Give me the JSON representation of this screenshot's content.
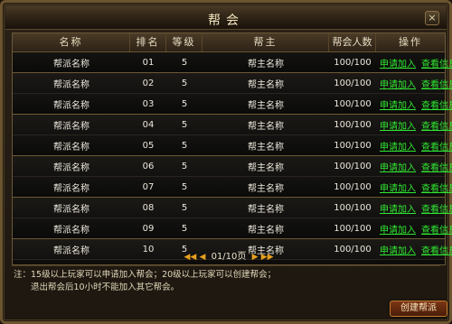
{
  "window": {
    "title": "帮会",
    "close_symbol": "×"
  },
  "table": {
    "headers": [
      "名称",
      "排名",
      "等级",
      "帮主",
      "帮会人数",
      "操作"
    ],
    "rows": [
      {
        "name": "帮派名称",
        "rank": "01",
        "level": "5",
        "leader": "帮主名称",
        "members": "100/100",
        "join": "申请加入",
        "view": "查看信息"
      },
      {
        "name": "帮派名称",
        "rank": "02",
        "level": "5",
        "leader": "帮主名称",
        "members": "100/100",
        "join": "申请加入",
        "view": "查看信息"
      },
      {
        "name": "帮派名称",
        "rank": "03",
        "level": "5",
        "leader": "帮主名称",
        "members": "100/100",
        "join": "申请加入",
        "view": "查看信息"
      },
      {
        "name": "帮派名称",
        "rank": "04",
        "level": "5",
        "leader": "帮主名称",
        "members": "100/100",
        "join": "申请加入",
        "view": "查看信息"
      },
      {
        "name": "帮派名称",
        "rank": "05",
        "level": "5",
        "leader": "帮主名称",
        "members": "100/100",
        "join": "申请加入",
        "view": "查看信息"
      },
      {
        "name": "帮派名称",
        "rank": "06",
        "level": "5",
        "leader": "帮主名称",
        "members": "100/100",
        "join": "申请加入",
        "view": "查看信息"
      },
      {
        "name": "帮派名称",
        "rank": "07",
        "level": "5",
        "leader": "帮主名称",
        "members": "100/100",
        "join": "申请加入",
        "view": "查看信息"
      },
      {
        "name": "帮派名称",
        "rank": "08",
        "level": "5",
        "leader": "帮主名称",
        "members": "100/100",
        "join": "申请加入",
        "view": "查看信息"
      },
      {
        "name": "帮派名称",
        "rank": "09",
        "level": "5",
        "leader": "帮主名称",
        "members": "100/100",
        "join": "申请加入",
        "view": "查看信息"
      },
      {
        "name": "帮派名称",
        "rank": "10",
        "level": "5",
        "leader": "帮主名称",
        "members": "100/100",
        "join": "申请加入",
        "view": "查看信息"
      }
    ]
  },
  "pager": {
    "text": "01/10页",
    "first_icon": "double-left-arrow-icon",
    "prev_icon": "left-arrow-icon",
    "next_icon": "right-arrow-icon",
    "last_icon": "double-right-arrow-icon"
  },
  "note": {
    "line1": "注：15级以上玩家可以申请加入帮会；20级以上玩家可以创建帮会；",
    "line2": "退出帮会后10小时不能加入其它帮会。"
  },
  "create_button": {
    "label": "创建帮派"
  },
  "colors": {
    "link": "#30e630",
    "accent": "#e7a01e",
    "button": "#7c3614"
  }
}
